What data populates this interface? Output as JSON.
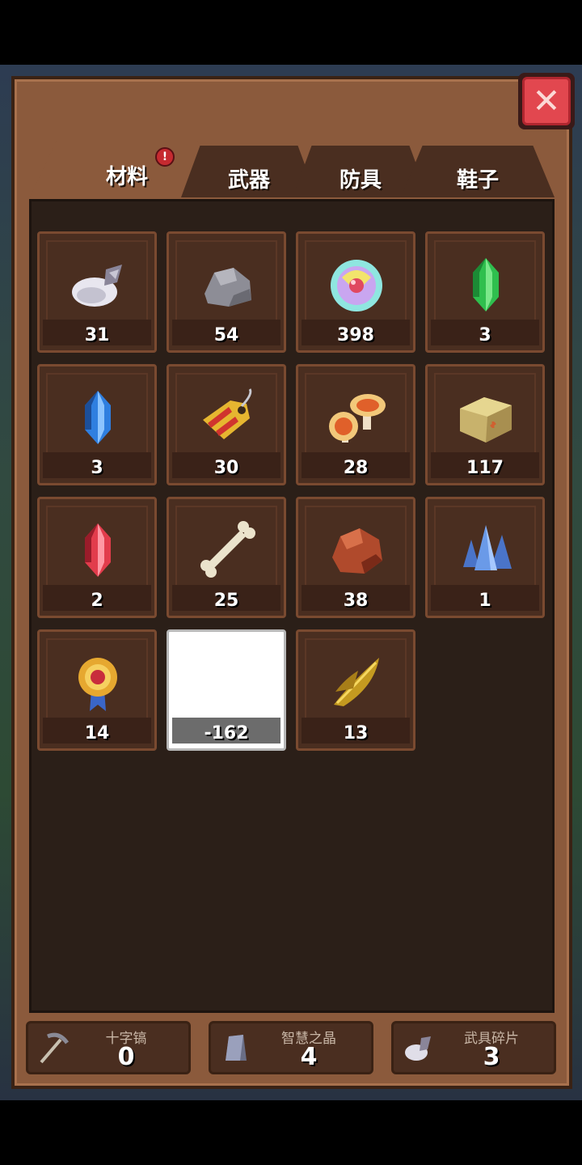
{
  "tabs": [
    {
      "label": "材料",
      "active": true,
      "badge": "!"
    },
    {
      "label": "武器",
      "active": false
    },
    {
      "label": "防具",
      "active": false
    },
    {
      "label": "鞋子",
      "active": false
    }
  ],
  "close_icon": "close-x-icon",
  "items": [
    {
      "icon": "cloth-sack-icon",
      "count": "31"
    },
    {
      "icon": "stone-icon",
      "count": "54"
    },
    {
      "icon": "rainbow-orb-icon",
      "count": "398"
    },
    {
      "icon": "green-crystal-icon",
      "count": "3"
    },
    {
      "icon": "blue-crystal-icon",
      "count": "3"
    },
    {
      "icon": "price-tag-icon",
      "count": "30"
    },
    {
      "icon": "mushroom-icon",
      "count": "28"
    },
    {
      "icon": "cardboard-box-icon",
      "count": "117"
    },
    {
      "icon": "red-crystal-icon",
      "count": "2"
    },
    {
      "icon": "bone-icon",
      "count": "25"
    },
    {
      "icon": "copper-ore-icon",
      "count": "38"
    },
    {
      "icon": "blue-crystal-cluster-icon",
      "count": "1"
    },
    {
      "icon": "gold-medal-icon",
      "count": "14"
    },
    {
      "icon": "blank-item",
      "count": "-162"
    },
    {
      "icon": "golden-leaf-icon",
      "count": "13"
    }
  ],
  "footer": [
    {
      "label": "十字镐",
      "value": "0",
      "icon": "pickaxe-icon"
    },
    {
      "label": "智慧之晶",
      "value": "4",
      "icon": "wisdom-crystal-icon"
    },
    {
      "label": "武具碎片",
      "value": "3",
      "icon": "armor-shard-icon"
    }
  ]
}
